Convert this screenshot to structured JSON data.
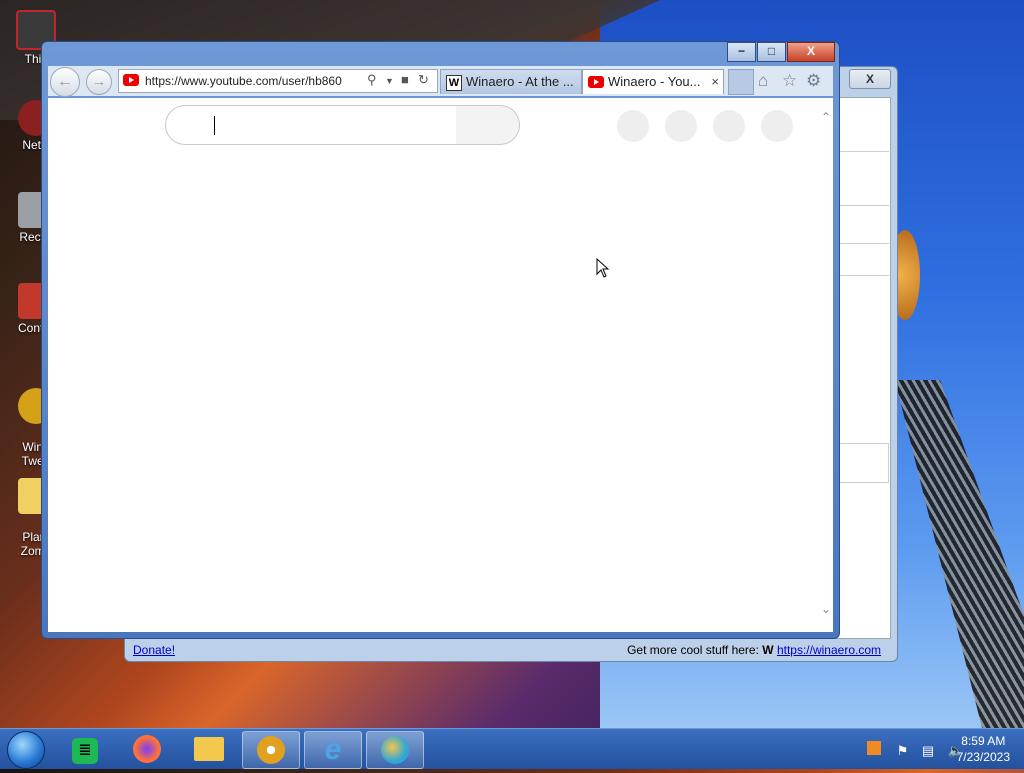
{
  "desktop": {
    "icons": [
      {
        "name": "this-pc",
        "label": "This",
        "color": "#c2262b"
      },
      {
        "name": "network",
        "label": "Netw",
        "color": "#b83a3a"
      },
      {
        "name": "recycle-bin",
        "label": "Recyc",
        "color": "#9aa0a6"
      },
      {
        "name": "control-panel",
        "label": "Contro",
        "color": "#c0392b"
      },
      {
        "name": "winaero-tweaker",
        "label": "Wina\nTwea",
        "color": "#d4a017"
      },
      {
        "name": "plants-vs-zombies",
        "label": "Plant\nZomb",
        "color": "#f0d060"
      }
    ]
  },
  "bg_window": {
    "close_label": "X",
    "status": {
      "donate": "Donate!",
      "more_text": "Get more cool stuff here:",
      "more_badge": "W",
      "more_link": "https://winaero.com"
    }
  },
  "browser": {
    "controls": {
      "minimize": "−",
      "maximize": "□",
      "close": "X"
    },
    "back_icon": "←",
    "forward_icon": "→",
    "address": {
      "url": "https://www.youtube.com/user/hb860"
    },
    "tabs": [
      {
        "label": "Winaero - At the ...",
        "favicon": "W",
        "active": false
      },
      {
        "label": "Winaero - You...",
        "favicon": "youtube",
        "active": true
      }
    ],
    "close_tab": "×"
  },
  "taskbar": {
    "apps": [
      {
        "name": "start-button"
      },
      {
        "name": "spotify",
        "glyph": "≣",
        "color": "#1db954"
      },
      {
        "name": "firefox",
        "glyph": "●",
        "color": "#ff7139"
      },
      {
        "name": "file-explorer",
        "glyph": "▤",
        "color": "#f2c94c"
      },
      {
        "name": "chrome-canary",
        "glyph": "◉",
        "color": "#e0a020"
      },
      {
        "name": "internet-explorer",
        "glyph": "e",
        "color": "#4fa3e8"
      },
      {
        "name": "edge",
        "glyph": "◐",
        "color": "#2fa7d8"
      }
    ],
    "clock": {
      "time": "8:59 AM",
      "date": "7/23/2023"
    }
  }
}
